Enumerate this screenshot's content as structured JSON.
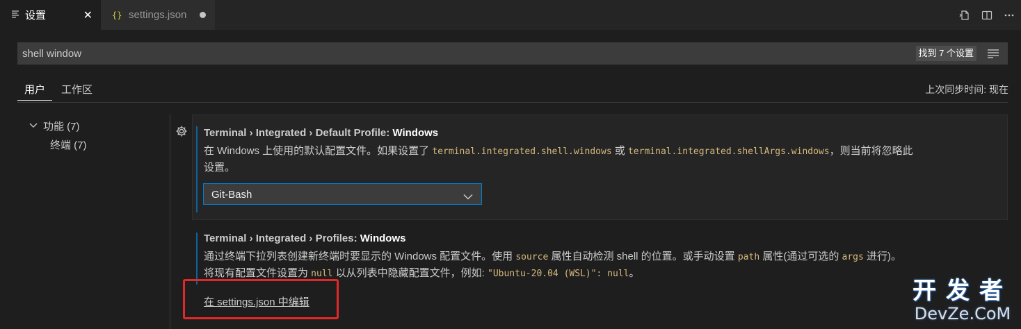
{
  "tabs": {
    "settings_label": "设置",
    "settings_icon": "settings-list-icon",
    "close_glyph": "✕",
    "json_icon_text": "{}",
    "json_label": "settings.json"
  },
  "search": {
    "query": "shell window",
    "result_count": "找到 7 个设置"
  },
  "scopes": {
    "user": "用户",
    "workspace": "工作区"
  },
  "sync_status": "上次同步时间: 现在",
  "toc": {
    "group_label": "功能 (7)",
    "item_label": "终端 (7)"
  },
  "settings": [
    {
      "category": "Terminal › Integrated › Default Profile: ",
      "name": "Windows",
      "desc_line1_a": "在 Windows 上使用的默认配置文件。如果设置了 ",
      "code1": "terminal.integrated.shell.windows",
      "desc_line1_b": " 或 ",
      "code2": "terminal.integrated.shellArgs.windows",
      "desc_line1_c": "，则当前将忽略此",
      "desc_line2": "设置。",
      "dropdown_value": "Git-Bash"
    },
    {
      "category": "Terminal › Integrated › Profiles: ",
      "name": "Windows",
      "desc_line1_a": "通过终端下拉列表创建新终端时要显示的 Windows 配置文件。使用 ",
      "code1": "source",
      "desc_line1_b": " 属性自动检测 shell 的位置。或手动设置 ",
      "code2": "path",
      "desc_line1_c": " 属性(通过可选的 ",
      "code3": "args",
      "desc_line1_d": " 进行)。",
      "desc_line2_a": "将现有配置文件设置为 ",
      "code4": "null",
      "desc_line2_b": " 以从列表中隐藏配置文件，例如: ",
      "code5": "\"Ubuntu-20.04 (WSL)\": null",
      "desc_line2_c": "。",
      "edit_link": "在 settings.json 中编辑"
    }
  ],
  "watermark": {
    "line1": "开发者",
    "line2": "DevZe.CoM"
  },
  "colors": {
    "accent": "#007fd4",
    "highlight_box": "#e32828",
    "code_text": "#d7ba7d"
  }
}
